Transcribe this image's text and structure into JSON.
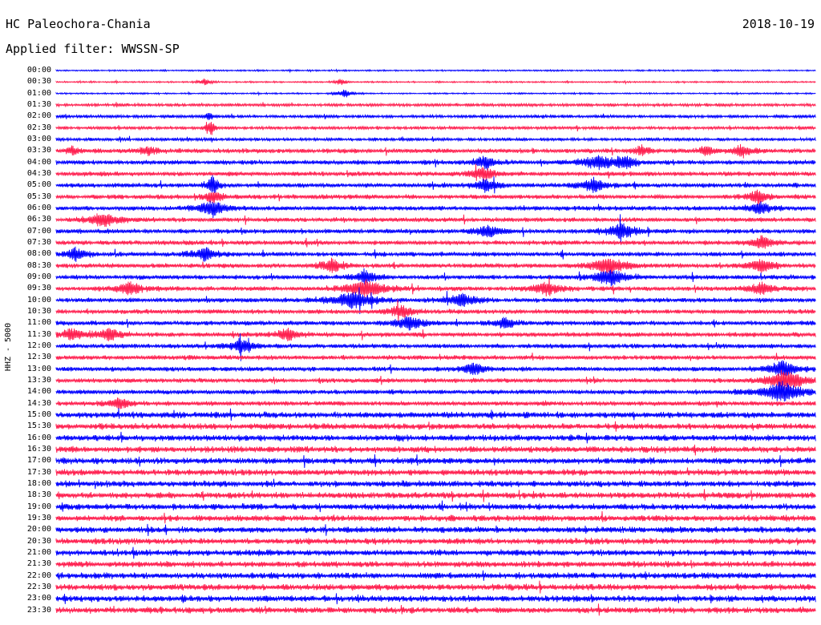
{
  "header": {
    "station": "HC Paleochora-Chania",
    "date": "2018-10-19",
    "filter_prefix": "Applied filter:",
    "filter": "WWSSN-SP"
  },
  "channel_label": "HHZ - 5000",
  "colors": {
    "trace_a": "#0000ff",
    "trace_b": "#ff2050"
  },
  "time_labels": [
    "00:00",
    "00:30",
    "01:00",
    "01:30",
    "02:00",
    "02:30",
    "03:00",
    "03:30",
    "04:00",
    "04:30",
    "05:00",
    "05:30",
    "06:00",
    "06:30",
    "07:00",
    "07:30",
    "08:00",
    "08:30",
    "09:00",
    "09:30",
    "10:00",
    "10:30",
    "11:00",
    "11:30",
    "12:00",
    "12:30",
    "13:00",
    "13:30",
    "14:00",
    "14:30",
    "15:00",
    "15:30",
    "16:00",
    "16:30",
    "17:00",
    "17:30",
    "18:00",
    "18:30",
    "19:00",
    "19:30",
    "20:00",
    "20:30",
    "21:00",
    "21:30",
    "22:00",
    "22:30",
    "23:00",
    "23:30"
  ]
}
